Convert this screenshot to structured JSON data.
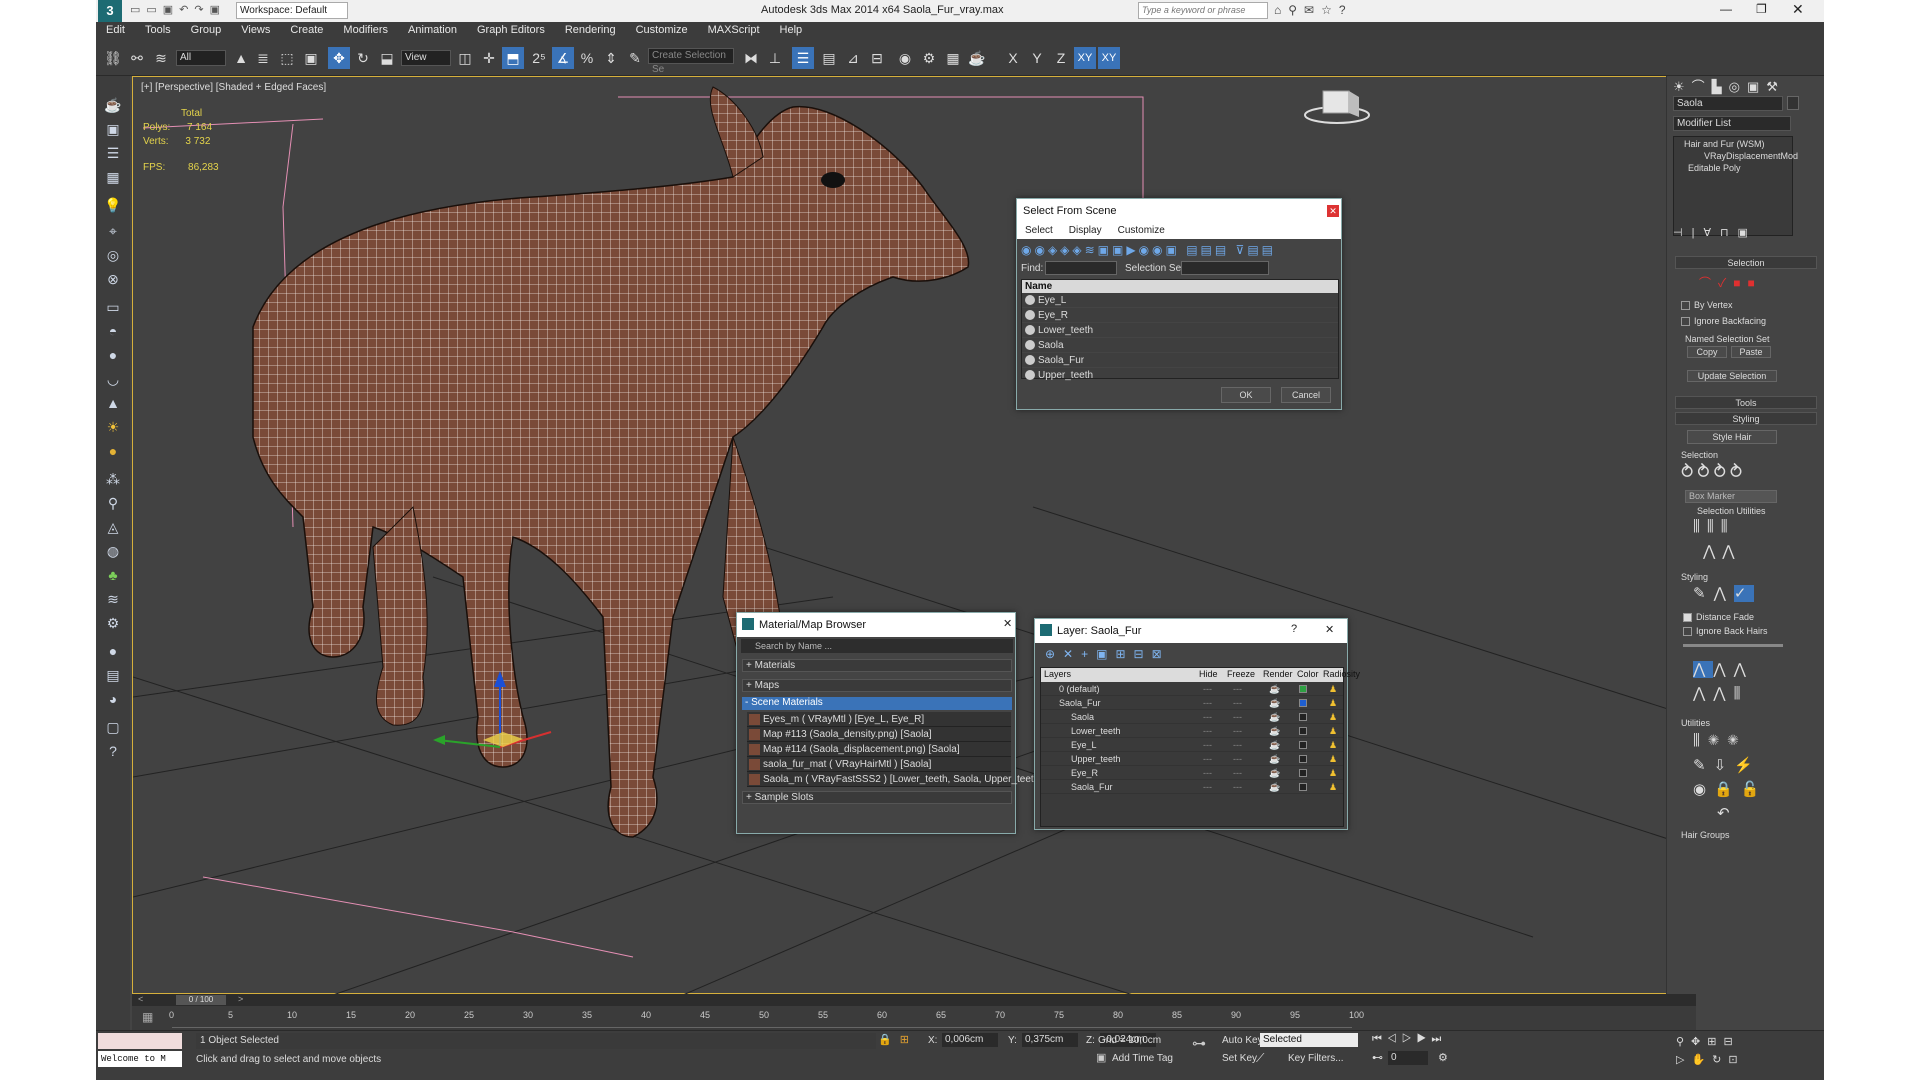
{
  "title": "Autodesk 3ds Max  2014 x64     Saola_Fur_vray.max",
  "workspace": "Workspace: Default",
  "search_placeholder": "Type a keyword or phrase",
  "menu": [
    "Edit",
    "Tools",
    "Group",
    "Views",
    "Create",
    "Modifiers",
    "Animation",
    "Graph Editors",
    "Rendering",
    "Customize",
    "MAXScript",
    "Help"
  ],
  "toolbar": {
    "filter": "All",
    "refcoord": "View",
    "selset": "Create Selection Se",
    "axes": [
      "X",
      "Y",
      "Z",
      "XY",
      "XY"
    ]
  },
  "viewport": {
    "label": "[+] [Perspective] [Shaded + Edged Faces]",
    "stats": {
      "total": "Total",
      "polys_label": "Polys:",
      "polys": "7 164",
      "verts_label": "Verts:",
      "verts": "3 732",
      "fps_label": "FPS:",
      "fps": "86,283"
    }
  },
  "select_from_scene": {
    "title": "Select From Scene",
    "menu": [
      "Select",
      "Display",
      "Customize"
    ],
    "find_label": "Find:",
    "selset_label": "Selection Set:",
    "col_name": "Name",
    "items": [
      "Eye_L",
      "Eye_R",
      "Lower_teeth",
      "Saola",
      "Saola_Fur",
      "Upper_teeth"
    ],
    "ok": "OK",
    "cancel": "Cancel"
  },
  "material_browser": {
    "title": "Material/Map Browser",
    "search": "Search by Name ...",
    "groups": [
      "+ Materials",
      "+ Maps",
      "- Scene Materials",
      "+ Sample Slots"
    ],
    "scene_materials": [
      "Eyes_m  ( VRayMtl ) [Eye_L, Eye_R]",
      "Map #113 (Saola_density.png) [Saola]",
      "Map #114 (Saola_displacement.png) [Saola]",
      "saola_fur_mat  ( VRayHairMtl ) [Saola]",
      "Saola_m  ( VRayFastSSS2 ) [Lower_teeth, Saola, Upper_teeth]"
    ]
  },
  "layer_window": {
    "title": "Layer: Saola_Fur",
    "cols": [
      "Layers",
      "Hide",
      "Freeze",
      "Render",
      "Color",
      "Radiosity"
    ],
    "rows": [
      {
        "name": "0 (default)",
        "color": "#2ea043"
      },
      {
        "name": "Saola_Fur",
        "color": "#1f5fd0"
      },
      {
        "name": "Saola",
        "color": "#222222"
      },
      {
        "name": "Lower_teeth",
        "color": "#222222"
      },
      {
        "name": "Eye_L",
        "color": "#222222"
      },
      {
        "name": "Upper_teeth",
        "color": "#222222"
      },
      {
        "name": "Eye_R",
        "color": "#222222"
      },
      {
        "name": "Saola_Fur",
        "color": "#222222"
      }
    ]
  },
  "command_panel": {
    "object_name": "Saola",
    "modifier_list": "Modifier List",
    "stack": [
      "Hair and Fur (WSM)",
      "VRayDisplacementMod",
      "Editable Poly"
    ],
    "selection_hdr": "Selection",
    "by_vertex": "By Vertex",
    "ignore_backfacing": "Ignore Backfacing",
    "named_sel": "Named Selection Set",
    "copy": "Copy",
    "paste": "Paste",
    "update_sel": "Update Selection",
    "tools_hdr": "Tools",
    "styling_hdr": "Styling",
    "style_hair": "Style Hair",
    "sel_group": "Selection",
    "box_marker": "Box Marker",
    "sel_util": "Selection Utilities",
    "styling_group": "Styling",
    "distance_fade": "Distance Fade",
    "ignore_back_hairs": "Ignore Back Hairs",
    "utilities": "Utilities",
    "hair_groups": "Hair Groups"
  },
  "timeline": {
    "frame": "0 / 100",
    "ticks": [
      "0",
      "5",
      "10",
      "15",
      "20",
      "25",
      "30",
      "35",
      "40",
      "45",
      "50",
      "55",
      "60",
      "65",
      "70",
      "75",
      "80",
      "85",
      "90",
      "95",
      "100"
    ]
  },
  "status": {
    "welcome": "Welcome to M",
    "selected": "1 Object Selected",
    "hint": "Click and drag to select and move objects",
    "x_label": "X:",
    "x": "0,006cm",
    "y_label": "Y:",
    "y": "0,375cm",
    "z_label": "Z:",
    "z": "-0,024cm",
    "grid": "Grid = 10,0cm",
    "add_time_tag": "Add Time Tag",
    "auto_key": "Auto Key",
    "set_key": "Set Key",
    "selected_dd": "Selected",
    "key_filters": "Key Filters...",
    "frame_field": "0"
  }
}
